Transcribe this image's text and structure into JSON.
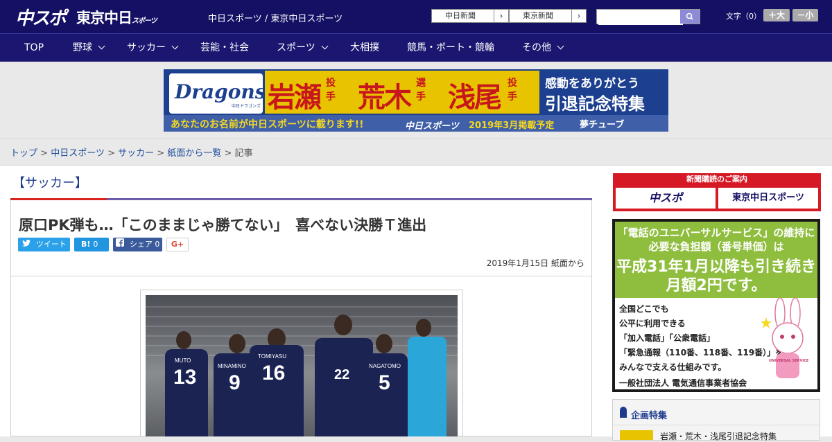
{
  "header": {
    "logo_chuspo": "中スポ",
    "logo_tokyo": "東京中日",
    "logo_tokyo_sub": "スポーツ",
    "site_name": "中日スポーツ / 東京中日スポーツ",
    "ext_links": [
      {
        "label": "中日新聞",
        "arrow": "›"
      },
      {
        "label": "東京新聞",
        "arrow": "›"
      }
    ],
    "search_placeholder": "",
    "font_size_label": "文字（0）",
    "font_plus": "＋大",
    "font_minus": "－小"
  },
  "nav": {
    "items": [
      {
        "label": "TOP",
        "has_menu": false
      },
      {
        "label": "野球",
        "has_menu": true
      },
      {
        "label": "サッカー",
        "has_menu": true
      },
      {
        "label": "芸能・社会",
        "has_menu": false
      },
      {
        "label": "スポーツ",
        "has_menu": true
      },
      {
        "label": "大相撲",
        "has_menu": false
      },
      {
        "label": "競馬・ボート・競輪",
        "has_menu": false
      },
      {
        "label": "その他",
        "has_menu": true
      }
    ]
  },
  "banner": {
    "team_logo": "Dragons",
    "team_logo_sub": "中日ドラゴンズ",
    "names": [
      "岩瀬",
      "荒木",
      "浅尾"
    ],
    "name_suffixes": [
      "投手",
      "選手",
      "投手"
    ],
    "thanks": "感動をありがとう",
    "feature": "引退記念特集",
    "strip_text": "あなたのお名前が中日スポーツに載ります!!",
    "strip_logo": "中日スポーツ",
    "strip_date": "2019年3月掲載予定",
    "strip_brand": "夢チューブ"
  },
  "breadcrumb": {
    "items": [
      "トップ",
      "中日スポーツ",
      "サッカー",
      "紙面から一覧"
    ],
    "separator": ">",
    "current": "記事"
  },
  "article": {
    "category": "【サッカー】",
    "headline": "原口PK弾も…「このままじゃ勝てない」　喜べない決勝Ｔ進出",
    "share": {
      "tweet_label": "ツイート",
      "hatena_label": "B!",
      "hatena_count": "0",
      "facebook_label": "シェア",
      "facebook_count": "0",
      "gplus_label": "G+"
    },
    "date": "2019年1月15日",
    "source": "紙面から",
    "photo_players": [
      {
        "name": "MUTO",
        "number": "13"
      },
      {
        "name": "MINAMINO",
        "number": "9"
      },
      {
        "name": "TOMIYASU",
        "number": "16"
      },
      {
        "name": "",
        "number": "22"
      },
      {
        "name": "NAGATOMO",
        "number": "5"
      }
    ]
  },
  "sidebar": {
    "subscribe": {
      "title": "新聞購読のご案内",
      "logos": [
        "中スポ",
        "東京中日スポーツ"
      ]
    },
    "ad": {
      "heading": "「電話のユニバーサルサービス」の維持に必要な負担額（番号単価）は",
      "highlight": "平成31年1月以降も引き続き月額2円です。",
      "lines": [
        "全国どこでも",
        "公平に利用できる",
        "「加入電話」「公衆電話」",
        "「緊急通報（110番、118番、119番）」を",
        "みんなで支える仕組みです。"
      ],
      "sponsor": "一般社団法人 電気通信事業者協会",
      "mascot_label": "UNIVERSAL SERVICE"
    },
    "feature": {
      "title": "企画特集",
      "items": [
        "岩瀬・荒木・浅尾引退記念特集"
      ]
    }
  }
}
